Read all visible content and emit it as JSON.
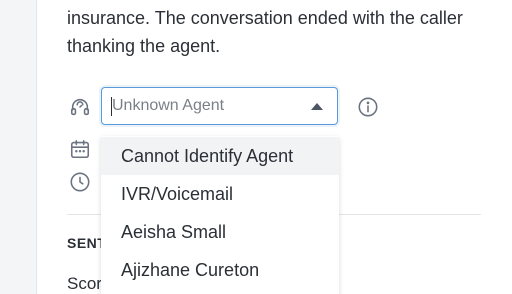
{
  "summary": {
    "line1": "insurance. The conversation ended with the caller",
    "line2": "thanking the agent."
  },
  "agent_select": {
    "value": "Unknown Agent",
    "options": [
      "Cannot Identify Agent",
      "IVR/Voicemail",
      "Aeisha Small",
      "Ajizhane Cureton"
    ],
    "highlighted_option": "Cannot Identify Agent"
  },
  "sections": {
    "sentiment_heading": "SENTIMENT",
    "score_label": "Score"
  },
  "icons": {
    "agent": "headset-icon",
    "date": "calendar-icon",
    "duration": "clock-icon",
    "info": "info-icon"
  },
  "colors": {
    "focus_border": "#5b9ad9",
    "text": "#2b2f36",
    "muted": "#7a8088",
    "hover_bg": "#f2f3f5"
  }
}
